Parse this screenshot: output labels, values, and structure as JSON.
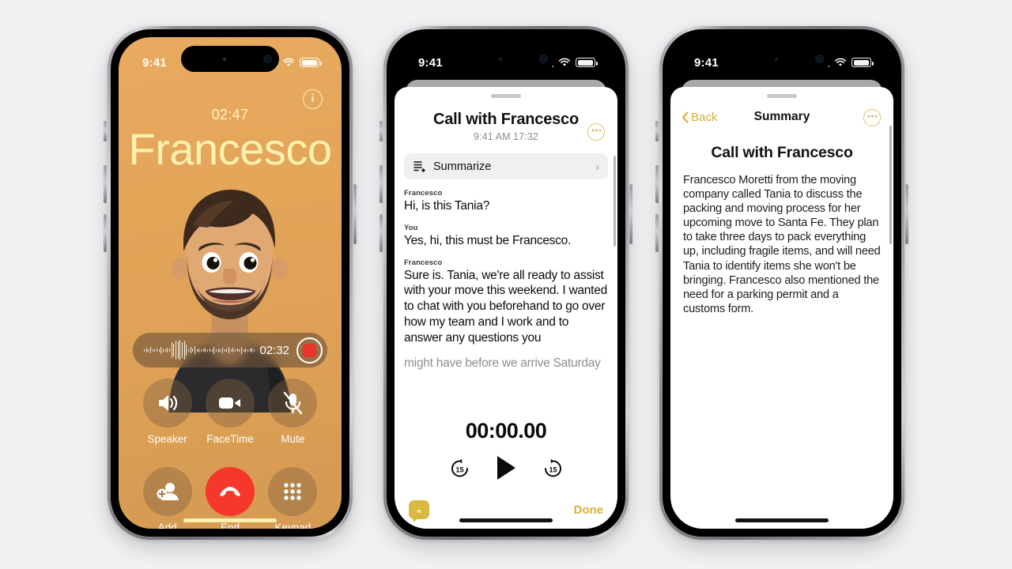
{
  "theme": {
    "page_bg": "#f1f1f3",
    "call_bg_top": "#e8aa5f",
    "call_bg_bottom": "#d49a53",
    "caller_name_color": "#fdf2ae",
    "accent_gold": "#d5b13d",
    "end_call_red": "#f5372c",
    "record_red": "#e8342c"
  },
  "phone1": {
    "name": "incoming-call-screen",
    "statusbar": {
      "time": "9:41",
      "cellular_icon": "cellular-bars-icon",
      "wifi_icon": "wifi-icon",
      "battery_icon": "battery-full-icon"
    },
    "info_button": {
      "icon": "info-circle-icon",
      "label": "i"
    },
    "call_timer": "02:47",
    "caller_name": "Francesco",
    "avatar": "memoji-avatar",
    "recording_bar": {
      "waveform_icon": "audio-waveform-icon",
      "elapsed": "02:32",
      "stop_button": "stop-recording-button"
    },
    "controls": [
      {
        "label": "Speaker",
        "icon": "speaker-wave-icon",
        "name": "speaker-button",
        "style": "normal"
      },
      {
        "label": "FaceTime",
        "icon": "video-camera-icon",
        "name": "facetime-button",
        "style": "normal"
      },
      {
        "label": "Mute",
        "icon": "microphone-slash-icon",
        "name": "mute-button",
        "style": "normal"
      },
      {
        "label": "Add",
        "icon": "add-person-icon",
        "name": "add-call-button",
        "style": "normal"
      },
      {
        "label": "End",
        "icon": "phone-down-icon",
        "name": "end-call-button",
        "style": "end"
      },
      {
        "label": "Keypad",
        "icon": "keypad-grid-icon",
        "name": "keypad-button",
        "style": "normal"
      }
    ]
  },
  "phone2": {
    "name": "call-recording-transcript-sheet",
    "statusbar": {
      "time": "9:41",
      "cellular_icon": "cellular-bars-icon",
      "wifi_icon": "wifi-icon",
      "battery_icon": "battery-full-icon"
    },
    "sheet_title": "Call with Francesco",
    "sheet_subtitle": "9:41 AM  17:32",
    "more_button": "more-options-button",
    "summarize": {
      "label": "Summarize",
      "icon": "summarize-list-icon",
      "chevron": "chevron-right-icon"
    },
    "transcript": [
      {
        "speaker": "Francesco",
        "text": "Hi, is this Tania?",
        "faded": false
      },
      {
        "speaker": "You",
        "text": "Yes, hi, this must be Francesco.",
        "faded": false
      },
      {
        "speaker": "Francesco",
        "text": "Sure is. Tania, we're all ready to assist with your move this weekend. I wanted to chat with you beforehand to go over how my team and I work and to answer any questions you",
        "faded": false
      },
      {
        "speaker": "",
        "text": "might have before we arrive Saturday",
        "faded": true
      }
    ],
    "player": {
      "time": "00:00.00",
      "back_label": "15",
      "forward_label": "15",
      "play_button": "play-button",
      "back_button": "skip-back-15-button",
      "forward_button": "skip-forward-15-button"
    },
    "chat_button": "live-transcript-button",
    "done_label": "Done"
  },
  "phone3": {
    "name": "call-summary-sheet",
    "statusbar": {
      "time": "9:41",
      "cellular_icon": "cellular-bars-icon",
      "wifi_icon": "wifi-icon",
      "battery_icon": "battery-full-icon"
    },
    "back_label": "Back",
    "nav_title": "Summary",
    "more_button": "more-options-button",
    "heading": "Call with Francesco",
    "body": "Francesco Moretti from the moving company called Tania to discuss the packing and moving process for her upcoming move to Santa Fe. They plan to take three days to pack everything up, including fragile items, and will need Tania to identify items she won't be bringing. Francesco also mentioned the need for a parking permit and a customs form."
  }
}
